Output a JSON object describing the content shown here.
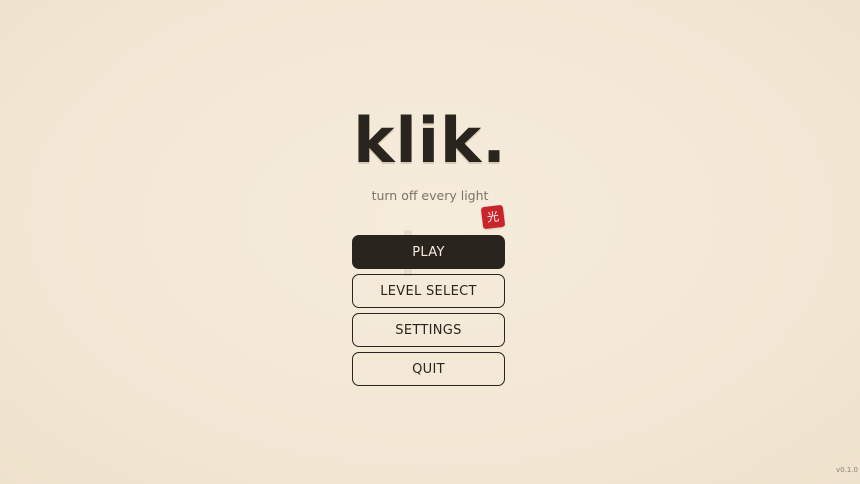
{
  "game": {
    "title": "klik.",
    "subtitle": "turn off every light",
    "stamp_glyph": "光",
    "version": "v0.1.0"
  },
  "menu": {
    "items": [
      {
        "label": "PLAY",
        "primary": true
      },
      {
        "label": "LEVEL SELECT",
        "primary": false
      },
      {
        "label": "SETTINGS",
        "primary": false
      },
      {
        "label": "QUIT",
        "primary": false
      }
    ]
  },
  "colors": {
    "background": "#f3e8d6",
    "ink": "#2a241f",
    "muted_text": "#7d7368",
    "stamp_red": "#c8242c"
  }
}
